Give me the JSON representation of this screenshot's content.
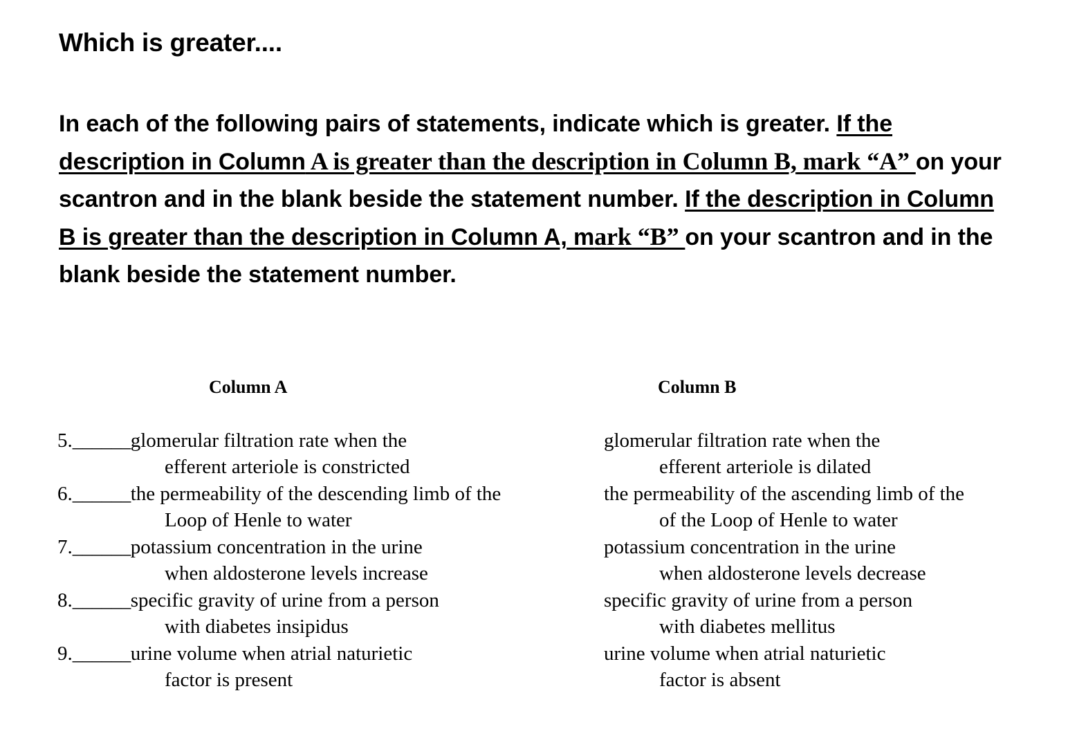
{
  "document": {
    "title": "Which is greater....",
    "instructions": {
      "seg1_sans": "In each of the following pairs of statements, indicate which is greater. ",
      "seg2_sans_u": "If the description in Column",
      "seg3_serif_u": " A is greater than the description in Column B,",
      "seg4_serif_u": " mark “A” ",
      "seg5_sans": "on your scantron and in the blank beside the statement number. ",
      "seg6_sans_u": "If the description in Column B is greater than the description in Column A,",
      "seg7_mixed_m_u": " m",
      "seg8_serif_u": "ark “B” ",
      "seg9_sans": "on your scantron and in the blank beside the statement number."
    },
    "columns": {
      "header_a": "Column A",
      "header_b": "Column B"
    },
    "pairs": [
      {
        "number": "5.",
        "blank": "______",
        "a_line1": "glomerular filtration rate when the",
        "a_line2": "efferent arteriole is constricted",
        "b_line1": "glomerular filtration rate when the",
        "b_line2": "efferent arteriole is dilated"
      },
      {
        "number": "6.",
        "blank": "______",
        "a_line1": "the permeability of the descending limb of the",
        "a_line2": "Loop of Henle to water",
        "b_line1": "the permeability of the ascending limb of the",
        "b_line2": "of the Loop of Henle to water"
      },
      {
        "number": "7.",
        "blank": "______",
        "a_line1": "potassium concentration in the urine",
        "a_line2": "when aldosterone levels increase",
        "b_line1": "potassium concentration in the urine",
        "b_line2": "when aldosterone levels decrease"
      },
      {
        "number": "8.",
        "blank": "______",
        "a_line1": "specific gravity of urine from a person",
        "a_line2": "with diabetes insipidus",
        "b_line1": "specific gravity of urine from a person",
        "b_line2": "with diabetes mellitus"
      },
      {
        "number": "9.",
        "blank": "______",
        "a_line1": "urine volume when atrial naturietic",
        "a_line2": "factor is present",
        "b_line1": "urine volume when atrial naturietic",
        "b_line2": "factor is absent"
      }
    ]
  },
  "colors": {
    "text": "#000000",
    "background": "#ffffff"
  }
}
